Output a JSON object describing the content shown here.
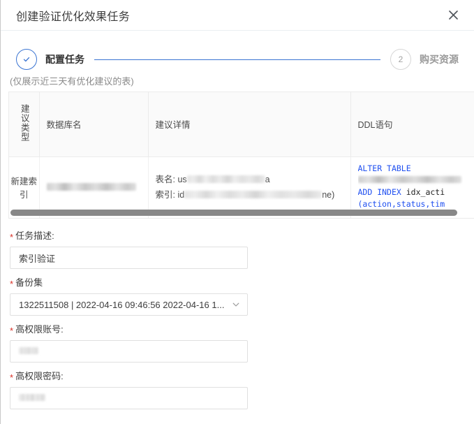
{
  "dialog": {
    "title": "创建验证优化效果任务",
    "close_icon": "close-icon"
  },
  "steps": [
    {
      "index": "1",
      "marker": "✓",
      "label": "配置任务",
      "state": "done"
    },
    {
      "index": "2",
      "marker": "2",
      "label": "购买资源",
      "state": "todo"
    }
  ],
  "table": {
    "note": "(仅展示近三天有优化建议的表)",
    "columns": [
      {
        "key": "type",
        "label": "建议类型"
      },
      {
        "key": "db",
        "label": "数据库名"
      },
      {
        "key": "detail",
        "label": "建议详情"
      },
      {
        "key": "ddl",
        "label": "DDL语句"
      }
    ],
    "rows": [
      {
        "type": "新建索引",
        "db": "[redacted]",
        "detail": {
          "table_label": "表名:",
          "table_prefix": "us",
          "table_suffix": "a",
          "index_label": "索引:",
          "index_prefix": "id",
          "index_suffix": "ne)"
        },
        "ddl": {
          "line1_kw": "ALTER TABLE",
          "line2_redacted": "[redacted]",
          "line3_kw": "ADD INDEX",
          "line3_id": "idx_acti",
          "line4": "(action,status,tim"
        }
      }
    ],
    "scrollbar": "horizontal-scrollbar"
  },
  "form": {
    "fields": [
      {
        "name": "task-description",
        "label": "任务描述:",
        "required": true,
        "type": "text",
        "value": "索引验证"
      },
      {
        "name": "backup-set",
        "label": "备份集",
        "required": true,
        "type": "select",
        "value": "1322511508 | 2022-04-16 09:46:56 2022-04-16 1...",
        "chevron_icon": "chevron-down-icon"
      },
      {
        "name": "privileged-account",
        "label": "高权限账号:",
        "required": true,
        "type": "text",
        "value": "[redacted]"
      },
      {
        "name": "privileged-password",
        "label": "高权限密码:",
        "required": true,
        "type": "password",
        "value": "[redacted]"
      }
    ],
    "required_marker": "*"
  },
  "colors": {
    "accent": "#3a74d2",
    "required": "#d93026",
    "code_keyword": "#1f4ff0",
    "border": "#ebebeb",
    "header_bg": "#fafafa"
  }
}
